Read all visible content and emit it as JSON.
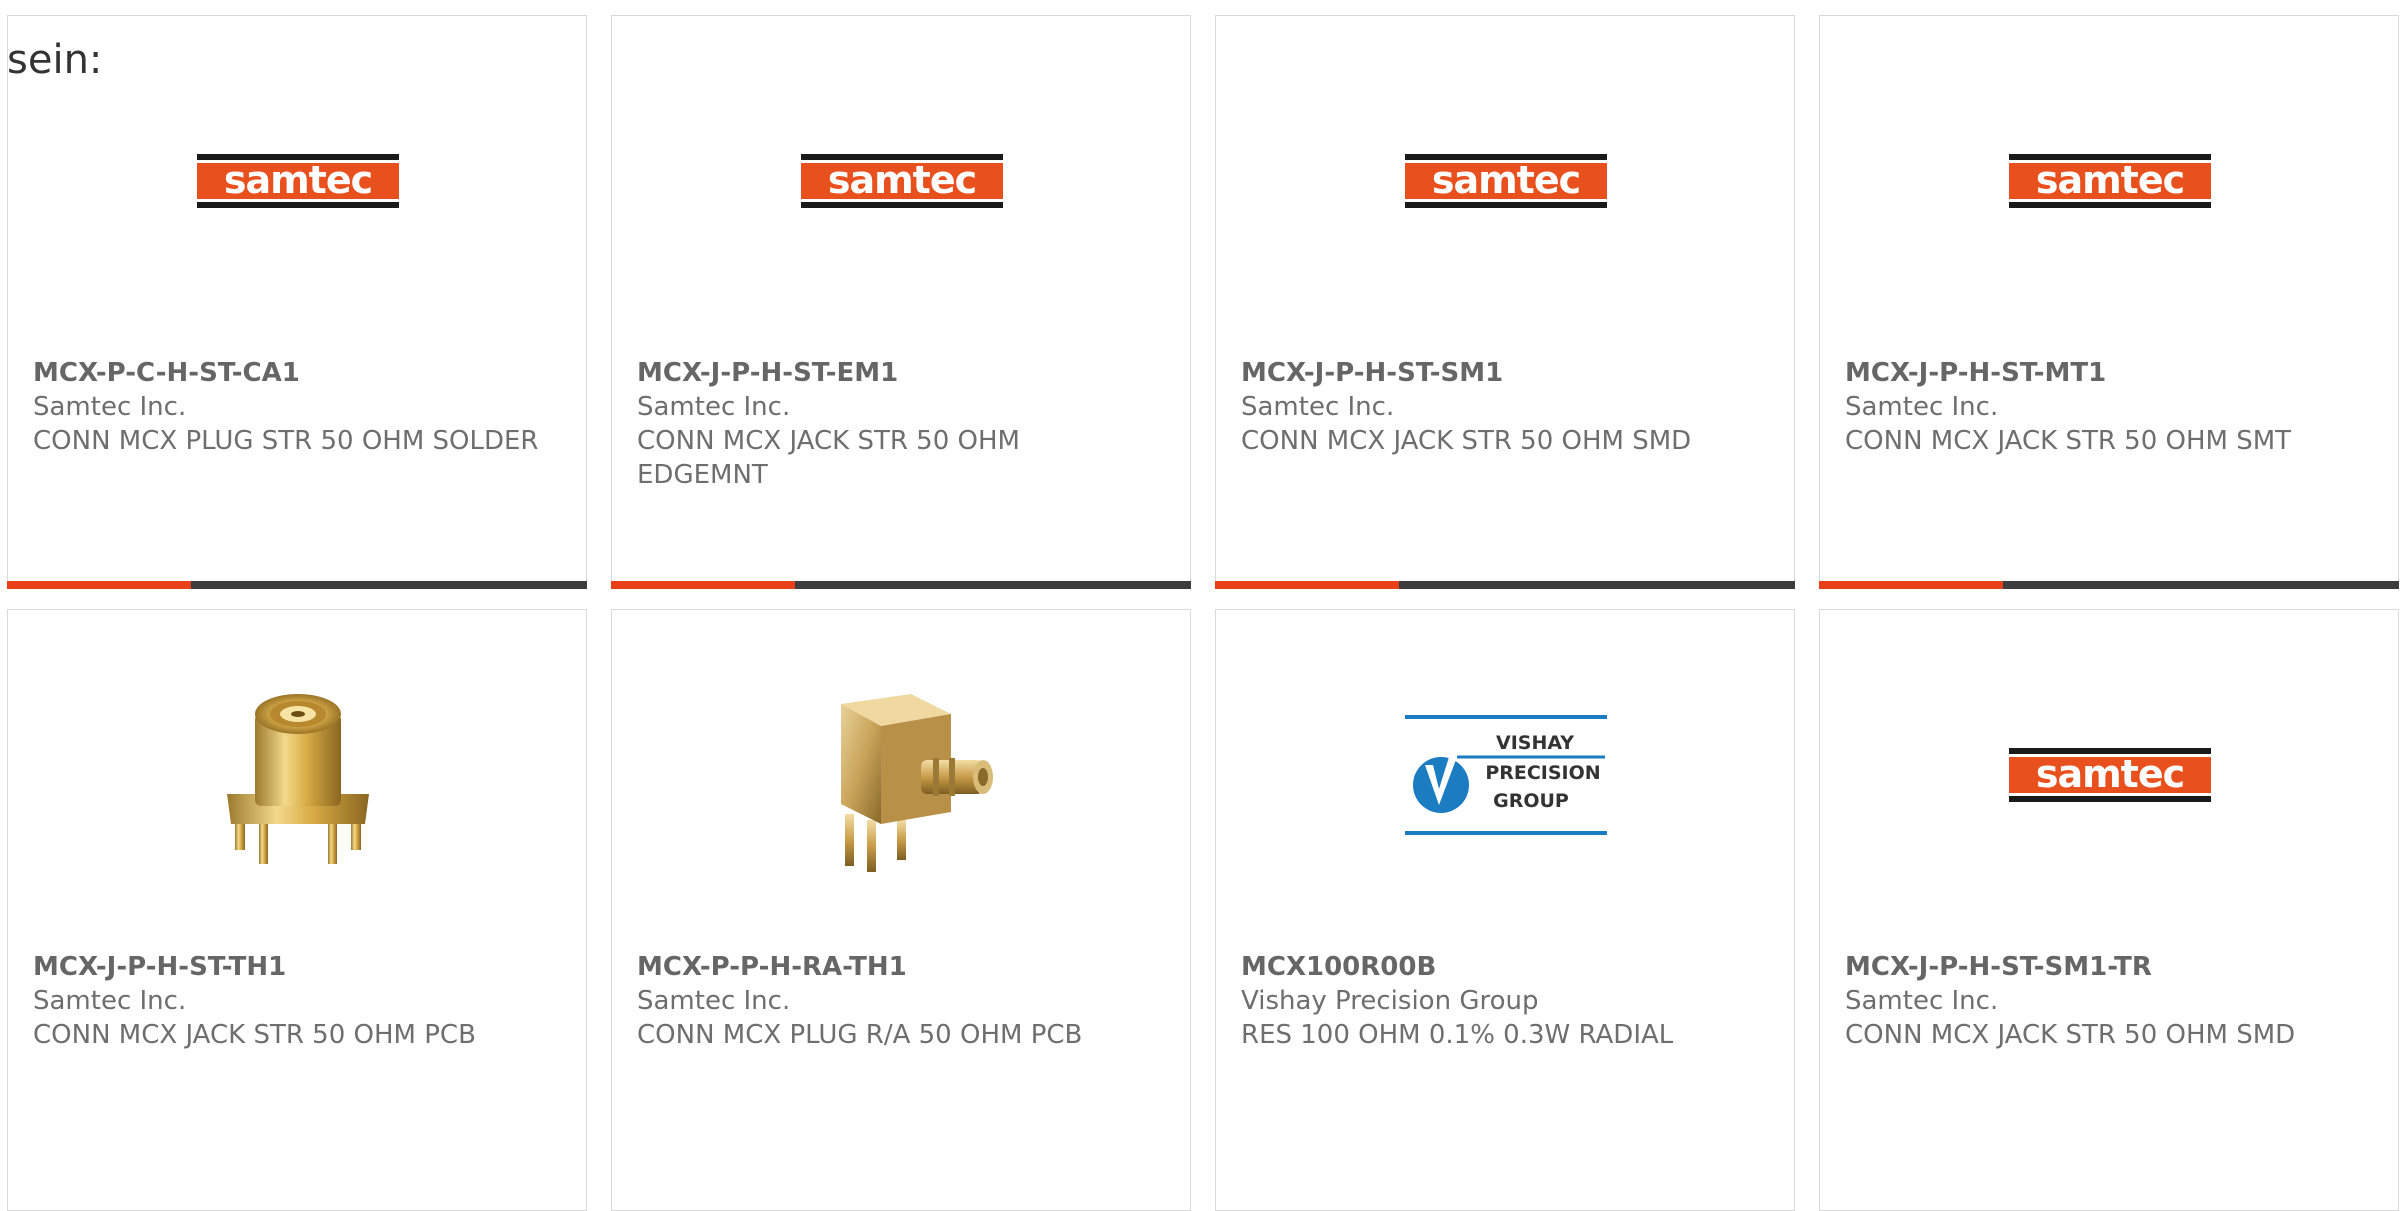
{
  "heading": "sein:",
  "colors": {
    "accent": "#e8411a",
    "bar": "#3d3d3d",
    "text": "#6e6e6e",
    "samtec_orange": "#e8501e",
    "vishay_blue": "#1b7cc1"
  },
  "products": [
    {
      "part_number": "MCX-P-C-H-ST-CA1",
      "manufacturer": "Samtec Inc.",
      "description": "CONN MCX PLUG STR 50 OHM SOLDER",
      "image": "samtec-logo",
      "logo_text": "samtec"
    },
    {
      "part_number": "MCX-J-P-H-ST-EM1",
      "manufacturer": "Samtec Inc.",
      "description": "CONN MCX JACK STR 50 OHM EDGEMNT",
      "image": "samtec-logo",
      "logo_text": "samtec"
    },
    {
      "part_number": "MCX-J-P-H-ST-SM1",
      "manufacturer": "Samtec Inc.",
      "description": "CONN MCX JACK STR 50 OHM SMD",
      "image": "samtec-logo",
      "logo_text": "samtec"
    },
    {
      "part_number": "MCX-J-P-H-ST-MT1",
      "manufacturer": "Samtec Inc.",
      "description": "CONN MCX JACK STR 50 OHM SMT",
      "image": "samtec-logo",
      "logo_text": "samtec"
    },
    {
      "part_number": "MCX-J-P-H-ST-TH1",
      "manufacturer": "Samtec Inc.",
      "description": "CONN MCX JACK STR 50 OHM PCB",
      "image": "connector-vertical-photo"
    },
    {
      "part_number": "MCX-P-P-H-RA-TH1",
      "manufacturer": "Samtec Inc.",
      "description": "CONN MCX PLUG R/A 50 OHM PCB",
      "image": "connector-right-angle-photo"
    },
    {
      "part_number": "MCX100R00B",
      "manufacturer": "Vishay Precision Group",
      "description": "RES 100 OHM 0.1% 0.3W RADIAL",
      "image": "vishay-logo",
      "logo_lines": [
        "VISHAY",
        "PRECISION",
        "GROUP"
      ]
    },
    {
      "part_number": "MCX-J-P-H-ST-SM1-TR",
      "manufacturer": "Samtec Inc.",
      "description": "CONN MCX JACK STR 50 OHM SMD",
      "image": "samtec-logo",
      "logo_text": "samtec"
    }
  ]
}
